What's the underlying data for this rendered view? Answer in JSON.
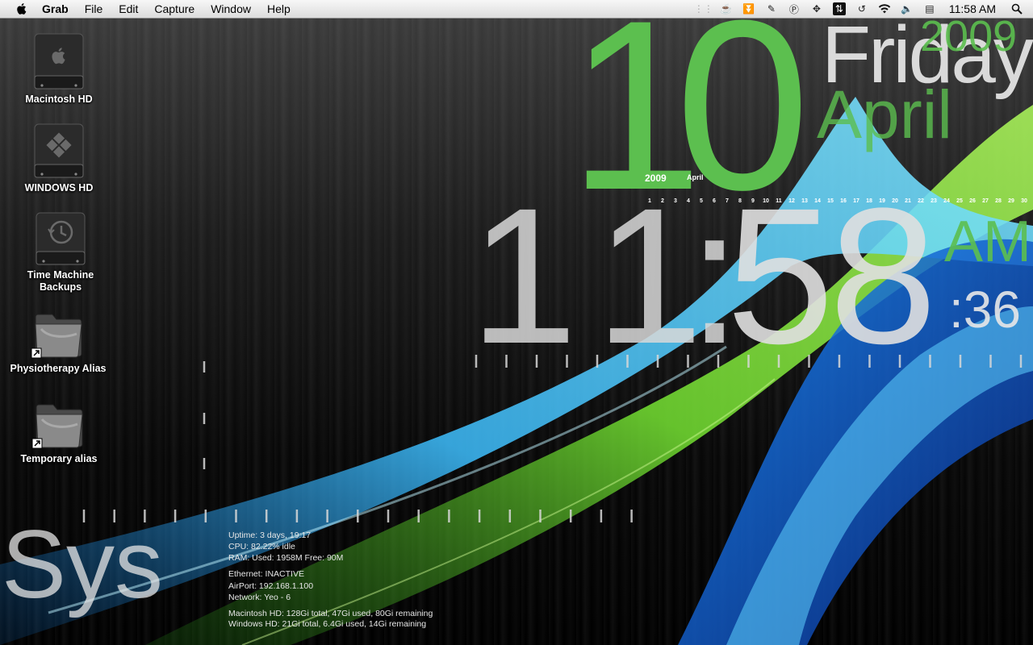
{
  "menubar": {
    "app": "Grab",
    "menus": [
      "File",
      "Edit",
      "Capture",
      "Window",
      "Help"
    ],
    "clock": "11:58 AM",
    "status_icons": [
      "spaces-icon",
      "coffee-icon",
      "eject-icon",
      "script-icon",
      "quicksilver-icon",
      "move-icon",
      "battery-status-icon",
      "time-machine-icon",
      "wifi-icon",
      "volume-icon",
      "input-icon",
      "spotlight-icon"
    ]
  },
  "desktop": {
    "icons": [
      {
        "label": "Macintosh HD",
        "icon": "hard-drive-icon"
      },
      {
        "label": "WINDOWS HD",
        "icon": "windows-drive-icon"
      },
      {
        "label": "Time Machine\nBackups",
        "line1": "Time Machine",
        "line2": "Backups",
        "icon": "time-machine-drive-icon"
      },
      {
        "label": "Physiotherapy Alias",
        "icon": "folder-alias-icon"
      },
      {
        "label": "Temporary alias",
        "icon": "folder-alias-icon"
      }
    ]
  },
  "clock_widget": {
    "day": "10",
    "weekday": "Friday",
    "year": "2009",
    "month": "April",
    "calendar_year": "2009",
    "calendar_month": "April",
    "calendar_days": [
      "1",
      "2",
      "3",
      "4",
      "5",
      "6",
      "7",
      "8",
      "9",
      "10",
      "11",
      "12",
      "13",
      "14",
      "15",
      "16",
      "17",
      "18",
      "19",
      "20",
      "21",
      "22",
      "23",
      "24",
      "25",
      "26",
      "27",
      "28",
      "29",
      "30"
    ],
    "hours": "11",
    "minutes": "58",
    "colon": ":",
    "ampm": "AM",
    "seconds": ":36"
  },
  "system_widget": {
    "title": "Sys",
    "uptime": "Uptime: 3 days, 19:17",
    "cpu": "CPU:  82.22% idle",
    "ram": "RAM:  Used: 1958M Free: 90M",
    "ethernet": "Ethernet: INACTIVE",
    "airport": "AirPort: 192.168.1.100",
    "network": "Network: Yeo - 6",
    "mac_hd": "Macintosh HD: 128Gi total, 47Gi used, 80Gi remaining",
    "win_hd": "Windows HD: 21Gi total, 6.4Gi used, 14Gi remaining"
  },
  "colors": {
    "accent_green": "#5cbf4f",
    "swoosh_blue": "#3cb8f5",
    "swoosh_green": "#6fd630"
  }
}
